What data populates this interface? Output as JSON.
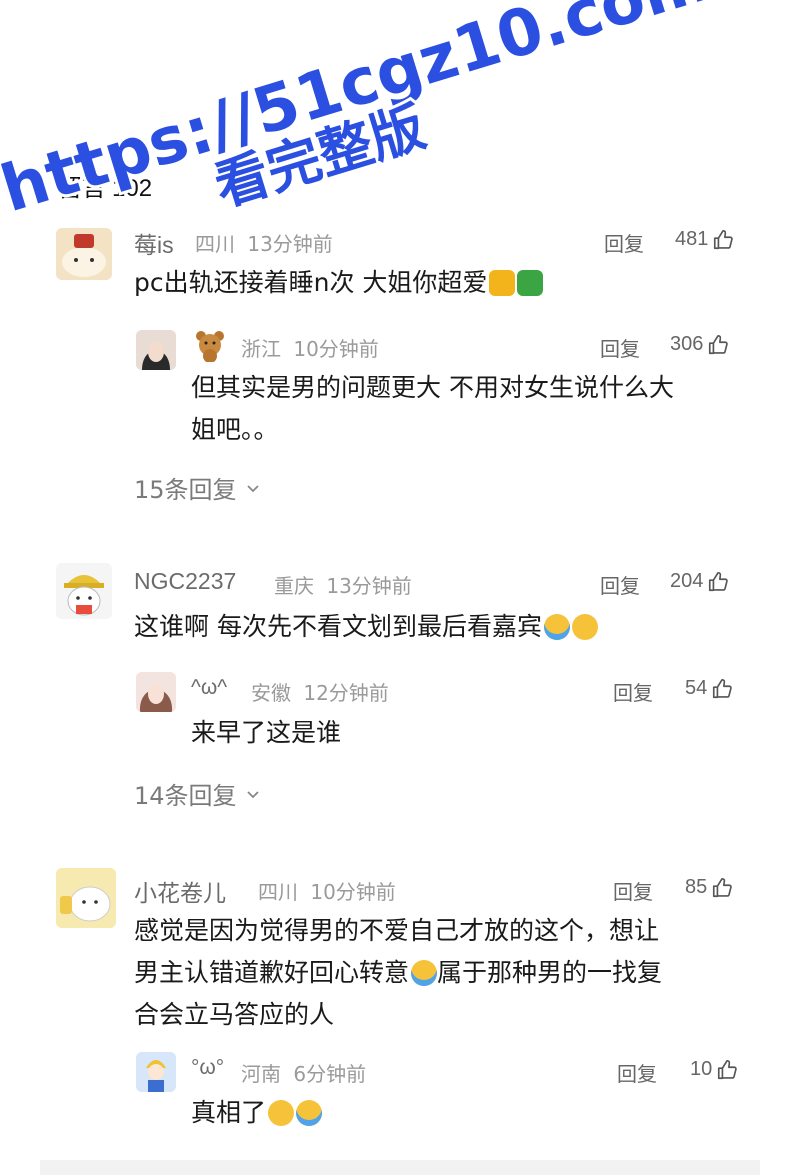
{
  "header": {
    "title": "留言",
    "count": "102"
  },
  "watermark": {
    "line1": "https://51cgz10.com",
    "line2": "看完整版"
  },
  "comments": [
    {
      "name": "莓is",
      "location": "四川",
      "time": "13分钟前",
      "reply_label": "回复",
      "likes": "481",
      "text": "pc出轨还接着睡n次 大姐你超爱",
      "emoji": "thumbs-up",
      "reply": {
        "name": "",
        "location": "浙江",
        "time": "10分钟前",
        "reply_label": "回复",
        "likes": "306",
        "text_line1": "但其实是男的问题更大 不用对女生说什么大",
        "text_line2": "姐吧。。"
      },
      "more_replies": "15条回复"
    },
    {
      "name": "NGC2237",
      "location": "重庆",
      "time": "13分钟前",
      "reply_label": "回复",
      "likes": "204",
      "text": "这谁啊 每次先不看文划到最后看嘉宾",
      "reply": {
        "name": "^ω^",
        "location": "安徽",
        "time": "12分钟前",
        "reply_label": "回复",
        "likes": "54",
        "text": "来早了这是谁"
      },
      "more_replies": "14条回复"
    },
    {
      "name": "小花卷儿",
      "location": "四川",
      "time": "10分钟前",
      "reply_label": "回复",
      "likes": "85",
      "text_line1": "感觉是因为觉得男的不爱自己才放的这个，想让",
      "text_line2a": "男主认错道歉好回心转意",
      "text_line2b": "属于那种男的一找复",
      "text_line3": "合会立马答应的人",
      "reply": {
        "name": "°ω°",
        "location": "河南",
        "time": "6分钟前",
        "reply_label": "回复",
        "likes": "10",
        "text": "真相了"
      }
    }
  ],
  "colors": {
    "watermark": "#2b4fe0",
    "text": "#1a1a1a",
    "meta": "#9a9a9a"
  }
}
